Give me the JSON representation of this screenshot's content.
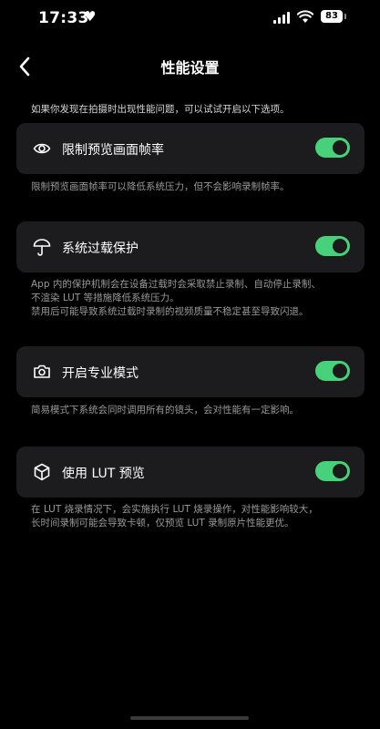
{
  "status_bar": {
    "time": "17:33",
    "heart": "♥",
    "battery": "83"
  },
  "nav": {
    "title": "性能设置"
  },
  "intro": "如果你发现在拍摄时出现性能问题，可以试试开启以下选项。",
  "settings": [
    {
      "label": "限制预览画面帧率",
      "icon": "eye-icon",
      "enabled": true,
      "description": [
        "限制预览画面帧率可以降低系统压力，但不会影响录制帧率。"
      ]
    },
    {
      "label": "系统过载保护",
      "icon": "umbrella-icon",
      "enabled": true,
      "description": [
        "App 内的保护机制会在设备过载时会采取禁止录制、自动停止录制、",
        "不渲染 LUT 等措施降低系统压力。",
        "禁用后可能导致系统过载时录制的视频质量不稳定甚至导致闪退。"
      ]
    },
    {
      "label": "开启专业模式",
      "icon": "camera-icon",
      "enabled": true,
      "description": [
        "简易模式下系统会同时调用所有的镜头，会对性能有一定影响。"
      ]
    },
    {
      "label": "使用 LUT 预览",
      "icon": "cube-icon",
      "enabled": true,
      "description": [
        "在 LUT 烧录情况下，会实施执行 LUT 烧录操作，对性能影响较大，",
        "长时间录制可能会导致卡顿，仅预览 LUT 录制原片性能更优。"
      ]
    }
  ],
  "colors": {
    "accent": "#46d17a",
    "card": "#1c1c1e",
    "background": "#000000"
  }
}
